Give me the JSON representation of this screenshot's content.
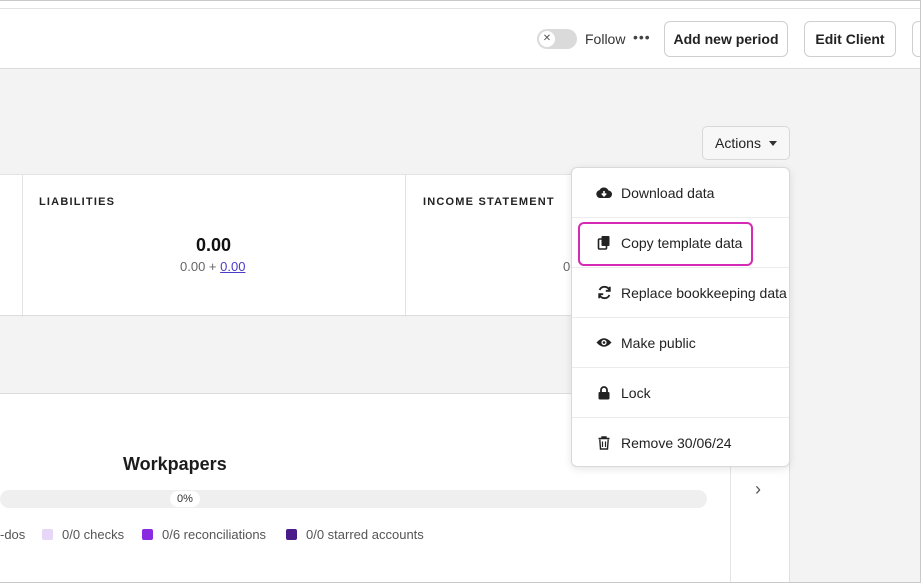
{
  "header": {
    "follow_label": "Follow",
    "more_icon": "more-horizontal-icon",
    "add_period_label": "Add new period",
    "edit_client_label": "Edit Client"
  },
  "actions": {
    "label": "Actions",
    "menu": [
      {
        "label": "Download data",
        "icon": "cloud-download-icon"
      },
      {
        "label": "Copy template data",
        "icon": "copy-icon"
      },
      {
        "label": "Replace bookkeeping data",
        "icon": "refresh-icon"
      },
      {
        "label": "Make public",
        "icon": "eye-icon"
      },
      {
        "label": "Lock",
        "icon": "lock-icon"
      },
      {
        "label": "Remove 30/06/24",
        "icon": "trash-icon"
      }
    ],
    "highlighted_item": "Copy template data",
    "highlight_color": "#d42ab4"
  },
  "cards": [
    {
      "title": "LIABILITIES",
      "value": "0.00",
      "sub_left": "0.00 + ",
      "sub_link": "0.00"
    },
    {
      "title": "INCOME STATEMENT",
      "value_partial": "0"
    }
  ],
  "workpapers": {
    "title": "Workpapers",
    "progress_percent": 0,
    "progress_label": "0%",
    "legend": [
      {
        "label": "-dos",
        "color": null
      },
      {
        "label": "0/0 checks",
        "color": "#e6d6f7"
      },
      {
        "label": "0/6 reconciliations",
        "color": "#8a2be2"
      },
      {
        "label": "0/0 starred accounts",
        "color": "#4b1a8a"
      }
    ]
  }
}
